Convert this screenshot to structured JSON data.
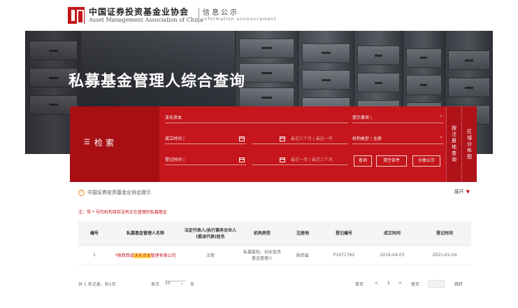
{
  "header": {
    "org_cn": "中国证券投资基金业协会",
    "org_en": "Asset Management Association of China",
    "info_cn": "信息公示",
    "info_en": "information announcement"
  },
  "banner": {
    "title": "私募基金管理人综合查询"
  },
  "search": {
    "label": "检索",
    "filter_icon": "filter-icon",
    "name_value": "沫东资本",
    "hint_label": "提示事项",
    "found_label": "成立时间",
    "reg_label": "登记时间",
    "quick_found": "最近三个月 | 最近一年",
    "quick_reg": "最近一月 | 最近三个月",
    "type_label": "机构类型",
    "type_value": "全部",
    "query_btn": "查询",
    "clear_btn": "清空条件",
    "category_btn": "分类公示",
    "tab_region": "按注册地查询",
    "tab_map": "区域分布图"
  },
  "notice": {
    "text": "中国证券投资基金业协会提示",
    "expand": "展开",
    "note": "注：带 * 号的机构目前没有正在管理的私募基金"
  },
  "table": {
    "headers": [
      "编号",
      "私募基金管理人名称",
      "法定代表人/执行事务合伙人(委派代表)姓名",
      "机构类型",
      "注册地",
      "登记编号",
      "成立时间",
      "登记时间"
    ],
    "rows": [
      {
        "no": "1",
        "name_pre": "*陕西西咸",
        "name_hl": "沫东资本",
        "name_post": "管理有限公司",
        "rep": "王新",
        "type": "私募股权、创业投资基金管理人",
        "region": "陕西省",
        "code": "P1071762",
        "founded": "2019-04-03",
        "registered": "2021-01-04"
      }
    ]
  },
  "pager": {
    "summary": "共 1 条记录，共1页",
    "show_label": "显示",
    "show_value": "10",
    "unit": "条",
    "first": "首页",
    "prev": "<",
    "page": "1",
    "next": ">",
    "last": "尾页",
    "jump": "跳转"
  }
}
